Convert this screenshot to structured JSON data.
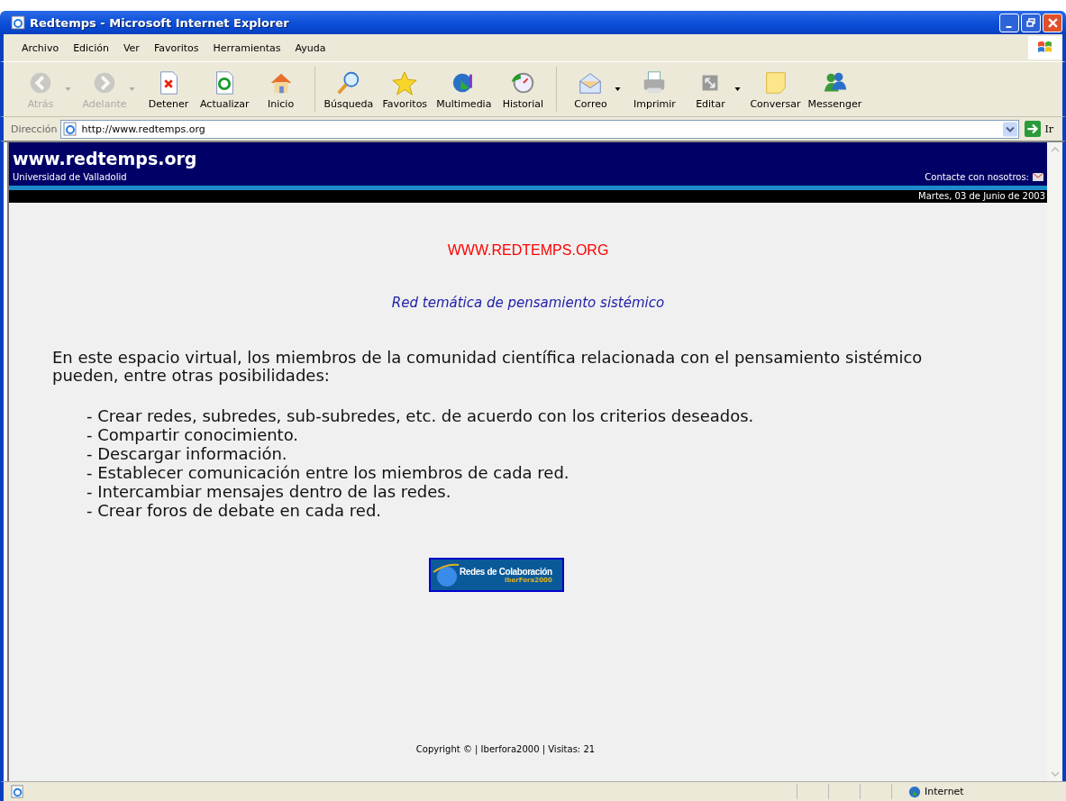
{
  "window": {
    "title": "Redtemps - Microsoft Internet Explorer"
  },
  "menu": [
    "Archivo",
    "Edición",
    "Ver",
    "Favoritos",
    "Herramientas",
    "Ayuda"
  ],
  "toolbar_groups": [
    [
      {
        "label": "Atrás",
        "disabled": true,
        "dropdown": true
      },
      {
        "label": "Adelante",
        "disabled": true,
        "dropdown": true
      },
      {
        "label": "Detener",
        "disabled": false,
        "dropdown": false
      },
      {
        "label": "Actualizar",
        "disabled": false,
        "dropdown": false
      },
      {
        "label": "Inicio",
        "disabled": false,
        "dropdown": false
      }
    ],
    [
      {
        "label": "Búsqueda",
        "disabled": false,
        "dropdown": false
      },
      {
        "label": "Favoritos",
        "disabled": false,
        "dropdown": false
      },
      {
        "label": "Multimedia",
        "disabled": false,
        "dropdown": false
      },
      {
        "label": "Historial",
        "disabled": false,
        "dropdown": false
      }
    ],
    [
      {
        "label": "Correo",
        "disabled": false,
        "dropdown": true
      },
      {
        "label": "Imprimir",
        "disabled": false,
        "dropdown": false
      },
      {
        "label": "Editar",
        "disabled": false,
        "dropdown": true
      },
      {
        "label": "Conversar",
        "disabled": false,
        "dropdown": false
      },
      {
        "label": "Messenger",
        "disabled": false,
        "dropdown": false
      }
    ]
  ],
  "address": {
    "label": "Dirección",
    "value": "http://www.redtemps.org",
    "go": "Ir"
  },
  "site": {
    "title": "www.redtemps.org",
    "subtitle": "Universidad de Valladolid",
    "contact": "Contacte con nosotros:",
    "date": "Martes, 03 de Junio de 2003"
  },
  "content": {
    "heading": "WWW.REDTEMPS.ORG",
    "tagline": "Red temática de pensamiento sistémico",
    "intro": "En este espacio virtual, los miembros de la comunidad científica relacionada con el pensamiento sistémico pueden, entre otras posibilidades:",
    "items": [
      "- Crear redes, subredes, sub-subredes, etc. de acuerdo con los criterios deseados.",
      "- Compartir conocimiento.",
      "- Descargar información.",
      "- Establecer comunicación entre los miembros de cada red.",
      "- Intercambiar mensajes dentro de las redes.",
      "- Crear foros de debate en cada red."
    ],
    "banner": {
      "title": "Redes de Colaboración",
      "subtitle": "IberFora2000"
    },
    "footer": "Copyright © | Iberfora2000 | Visitas: 21"
  },
  "status_bar": {
    "zone": "Internet"
  }
}
